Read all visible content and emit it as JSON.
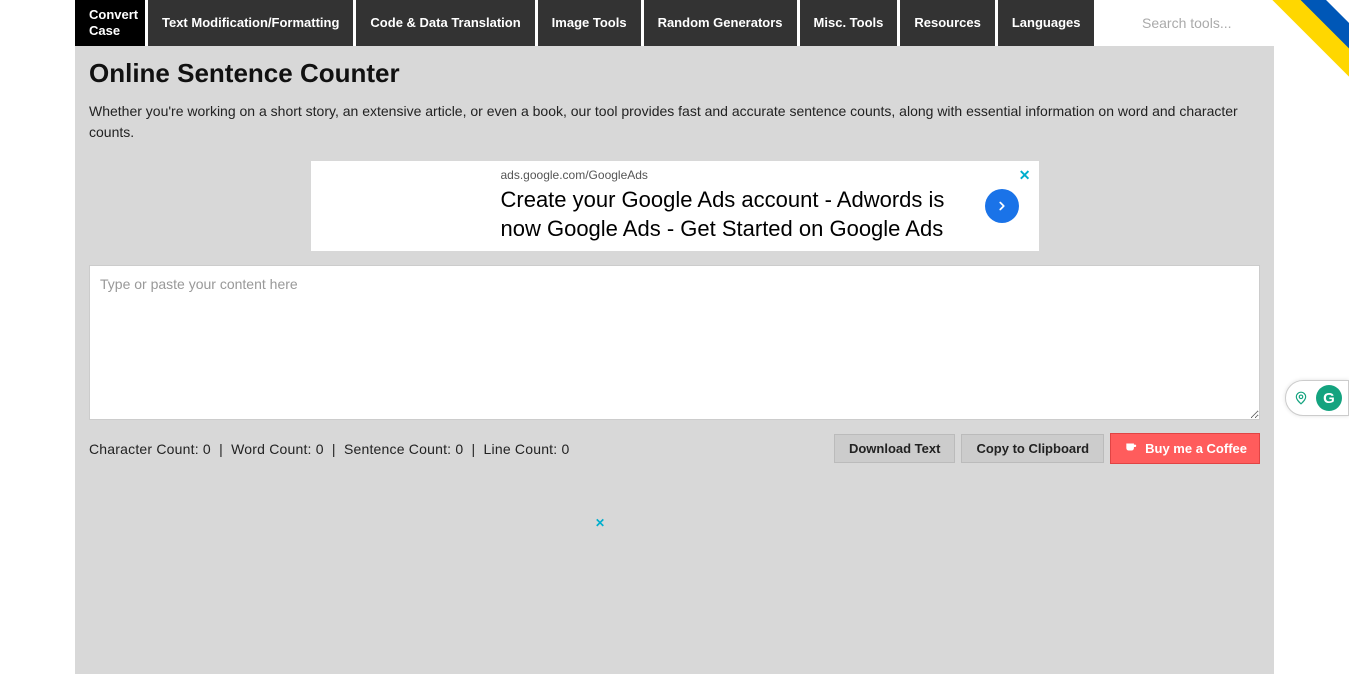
{
  "nav": {
    "items": [
      {
        "label": "Convert Case",
        "active": true,
        "twoLines": true
      },
      {
        "label": "Text Modification/Formatting"
      },
      {
        "label": "Code & Data Translation"
      },
      {
        "label": "Image Tools"
      },
      {
        "label": "Random Generators"
      },
      {
        "label": "Misc. Tools"
      },
      {
        "label": "Resources"
      },
      {
        "label": "Languages"
      }
    ],
    "search_placeholder": "Search tools..."
  },
  "page": {
    "title": "Online Sentence Counter",
    "description": "Whether you're working on a short story, an extensive article, or even a book, our tool provides fast and accurate sentence counts, along with essential information on word and character counts."
  },
  "ad": {
    "url": "ads.google.com/GoogleAds",
    "headline": "Create your Google Ads account - Adwords is now Google Ads - Get Started on Google Ads"
  },
  "input": {
    "placeholder": "Type or paste your content here"
  },
  "stats": {
    "char_label": "Character Count:",
    "char_value": "0",
    "word_label": "Word Count:",
    "word_value": "0",
    "sentence_label": "Sentence Count:",
    "sentence_value": "0",
    "line_label": "Line Count:",
    "line_value": "0"
  },
  "buttons": {
    "download": "Download Text",
    "copy": "Copy to Clipboard",
    "coffee": "Buy me a Coffee"
  }
}
